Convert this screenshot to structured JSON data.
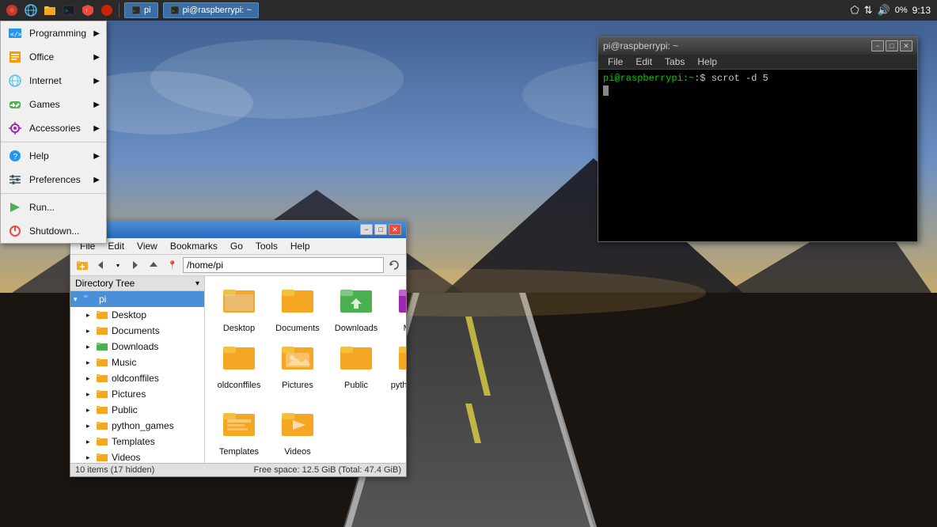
{
  "desktop": {
    "background_desc": "Road landscape at sunset"
  },
  "taskbar": {
    "icons": [
      {
        "name": "raspberry-icon",
        "symbol": "🍓"
      },
      {
        "name": "globe-icon",
        "symbol": "🌐"
      },
      {
        "name": "folder-icon",
        "symbol": "📁"
      },
      {
        "name": "terminal-small-icon",
        "symbol": "💻"
      },
      {
        "name": "shield-icon",
        "symbol": "🛡"
      },
      {
        "name": "red-icon",
        "symbol": "🔴"
      }
    ],
    "windows": [
      {
        "label": "pi",
        "id": "win-pi-1"
      },
      {
        "label": "pi@raspberrypi: ~",
        "id": "win-pi-2"
      }
    ],
    "systray": {
      "bluetooth": "BT",
      "network": "⇅",
      "volume": "🔊",
      "battery": "0%",
      "time": "9:13"
    }
  },
  "app_menu": {
    "items": [
      {
        "label": "Programming",
        "has_arrow": true,
        "icon": "⚙"
      },
      {
        "label": "Office",
        "has_arrow": true,
        "icon": "📄"
      },
      {
        "label": "Internet",
        "has_arrow": true,
        "icon": "🌐"
      },
      {
        "label": "Games",
        "has_arrow": true,
        "icon": "🎮"
      },
      {
        "label": "Accessories",
        "has_arrow": true,
        "icon": "🔧"
      },
      {
        "label": "Help",
        "has_arrow": true,
        "icon": "❓"
      },
      {
        "label": "Preferences",
        "has_arrow": true,
        "icon": "⚙"
      },
      {
        "label": "Run...",
        "has_arrow": false,
        "icon": "▶"
      },
      {
        "label": "Shutdown...",
        "has_arrow": false,
        "icon": "⏻"
      }
    ]
  },
  "file_manager": {
    "title": "pi",
    "menubar": [
      "File",
      "Edit",
      "View",
      "Bookmarks",
      "Go",
      "Tools",
      "Help"
    ],
    "address": "/home/pi",
    "tree_header": "Directory Tree",
    "tree_items": [
      {
        "label": "pi",
        "indent": 0,
        "selected": true,
        "icon": "folder"
      },
      {
        "label": "Desktop",
        "indent": 1,
        "icon": "folder"
      },
      {
        "label": "Documents",
        "indent": 1,
        "icon": "folder"
      },
      {
        "label": "Downloads",
        "indent": 1,
        "icon": "folder"
      },
      {
        "label": "Music",
        "indent": 1,
        "icon": "folder"
      },
      {
        "label": "oldconffiles",
        "indent": 1,
        "icon": "folder"
      },
      {
        "label": "Pictures",
        "indent": 1,
        "icon": "folder"
      },
      {
        "label": "Public",
        "indent": 1,
        "icon": "folder"
      },
      {
        "label": "python_games",
        "indent": 1,
        "icon": "folder"
      },
      {
        "label": "Templates",
        "indent": 1,
        "icon": "folder"
      },
      {
        "label": "Videos",
        "indent": 1,
        "icon": "folder"
      },
      {
        "label": "/",
        "indent": 0,
        "icon": "drive"
      }
    ],
    "files": [
      {
        "name": "Desktop",
        "icon": "folder-yellow"
      },
      {
        "name": "Documents",
        "icon": "folder-yellow"
      },
      {
        "name": "Downloads",
        "icon": "folder-green"
      },
      {
        "name": "Music",
        "icon": "folder-purple"
      },
      {
        "name": "oldconffiles",
        "icon": "folder-yellow"
      },
      {
        "name": "Pictures",
        "icon": "folder-yellow"
      },
      {
        "name": "Public",
        "icon": "folder-yellow"
      },
      {
        "name": "python_games",
        "icon": "folder-yellow"
      },
      {
        "name": "Templates",
        "icon": "folder-yellow"
      },
      {
        "name": "Videos",
        "icon": "folder-yellow"
      }
    ],
    "statusbar_left": "10 items (17 hidden)",
    "statusbar_right": "Free space: 12.5 GiB (Total: 47.4 GiB)"
  },
  "terminal": {
    "title": "pi@raspberrypi: ~",
    "menubar": [
      "File",
      "Edit",
      "Tabs",
      "Help"
    ],
    "prompt": "pi@raspberrypi:~",
    "command": "$ scrot -d 5"
  }
}
